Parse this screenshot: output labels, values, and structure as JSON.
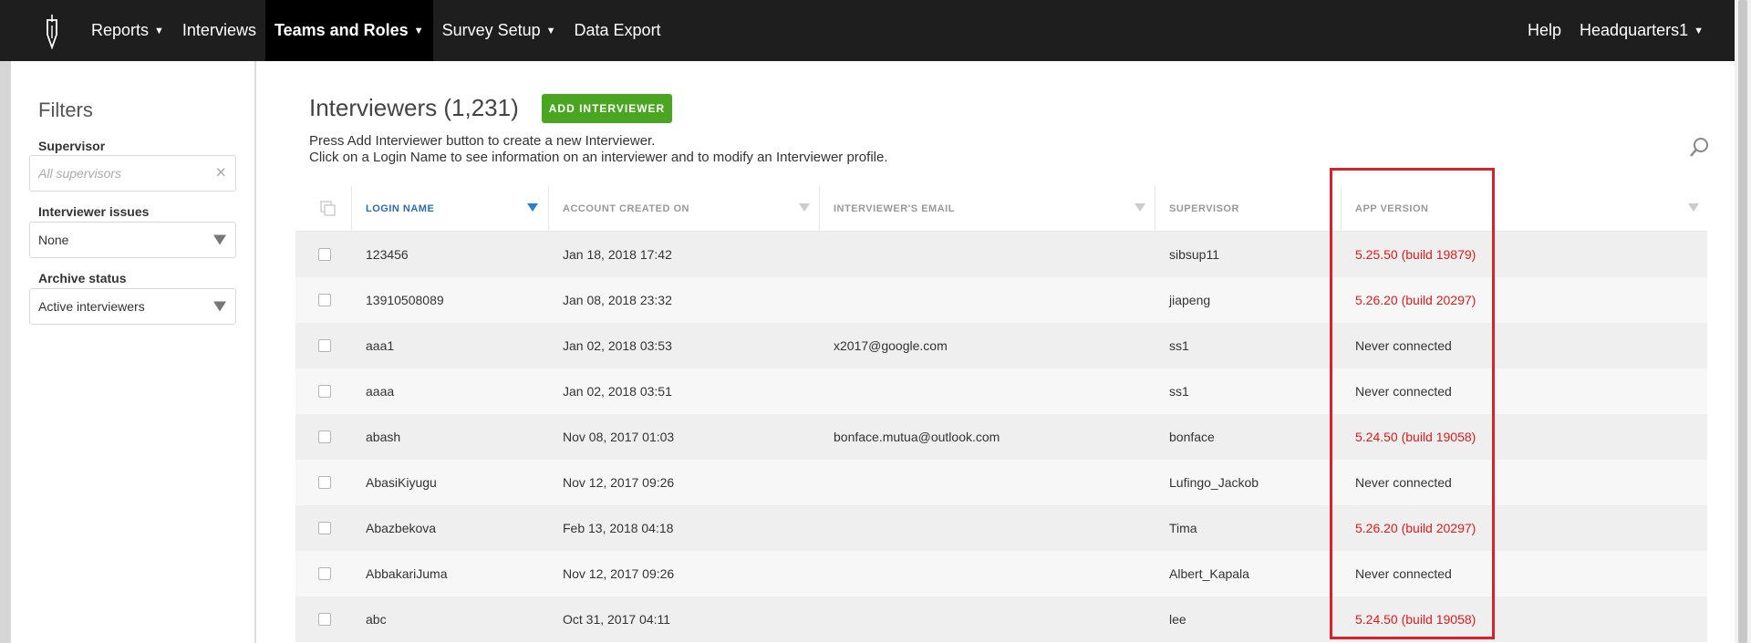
{
  "nav": {
    "items": [
      {
        "label": "Reports",
        "caret": true,
        "active": false
      },
      {
        "label": "Interviews",
        "caret": false,
        "active": false
      },
      {
        "label": "Teams and Roles",
        "caret": true,
        "active": true
      },
      {
        "label": "Survey Setup",
        "caret": true,
        "active": false
      },
      {
        "label": "Data Export",
        "caret": false,
        "active": false
      }
    ],
    "help_label": "Help",
    "user_label": "Headquarters1"
  },
  "sidebar": {
    "title": "Filters",
    "supervisor_label": "Supervisor",
    "supervisor_placeholder": "All supervisors",
    "issues_label": "Interviewer issues",
    "issues_value": "None",
    "archive_label": "Archive status",
    "archive_value": "Active interviewers"
  },
  "main": {
    "title": "Interviewers (1,231)",
    "add_button": "ADD INTERVIEWER",
    "desc_line1": "Press Add Interviewer button to create a new Interviewer.",
    "desc_line2": "Click on a Login Name to see information on an interviewer and to modify an Interviewer profile."
  },
  "table": {
    "columns": [
      "LOGIN NAME",
      "ACCOUNT CREATED ON",
      "INTERVIEWER'S EMAIL",
      "SUPERVISOR",
      "APP VERSION"
    ],
    "sorted_column": "LOGIN NAME",
    "rows": [
      {
        "login": "123456",
        "created": "Jan 18, 2018 17:42",
        "email": "",
        "supervisor": "sibsup11",
        "version": "5.25.50 (build 19879)",
        "outdated": true
      },
      {
        "login": "13910508089",
        "created": "Jan 08, 2018 23:32",
        "email": "",
        "supervisor": "jiapeng",
        "version": "5.26.20 (build 20297)",
        "outdated": true
      },
      {
        "login": "aaa1",
        "created": "Jan 02, 2018 03:53",
        "email": "x2017@google.com",
        "supervisor": "ss1",
        "version": "Never connected",
        "outdated": false
      },
      {
        "login": "aaaa",
        "created": "Jan 02, 2018 03:51",
        "email": "",
        "supervisor": "ss1",
        "version": "Never connected",
        "outdated": false
      },
      {
        "login": "abash",
        "created": "Nov 08, 2017 01:03",
        "email": "bonface.mutua@outlook.com",
        "supervisor": "bonface",
        "version": "5.24.50 (build 19058)",
        "outdated": true
      },
      {
        "login": "AbasiKiyugu",
        "created": "Nov 12, 2017 09:26",
        "email": "",
        "supervisor": "Lufingo_Jackob",
        "version": "Never connected",
        "outdated": false
      },
      {
        "login": "Abazbekova",
        "created": "Feb 13, 2018 04:18",
        "email": "",
        "supervisor": "Tima",
        "version": "5.26.20 (build 20297)",
        "outdated": true
      },
      {
        "login": "AbbakariJuma",
        "created": "Nov 12, 2017 09:26",
        "email": "",
        "supervisor": "Albert_Kapala",
        "version": "Never connected",
        "outdated": false
      },
      {
        "login": "abc",
        "created": "Oct 31, 2017 04:11",
        "email": "",
        "supervisor": "lee",
        "version": "5.24.50 (build 19058)",
        "outdated": true
      }
    ]
  },
  "colors": {
    "nav_bg": "#1e1e1e",
    "accent_green": "#4aa521",
    "outdated_red": "#e01b1b",
    "highlight_border": "#d9202b"
  }
}
